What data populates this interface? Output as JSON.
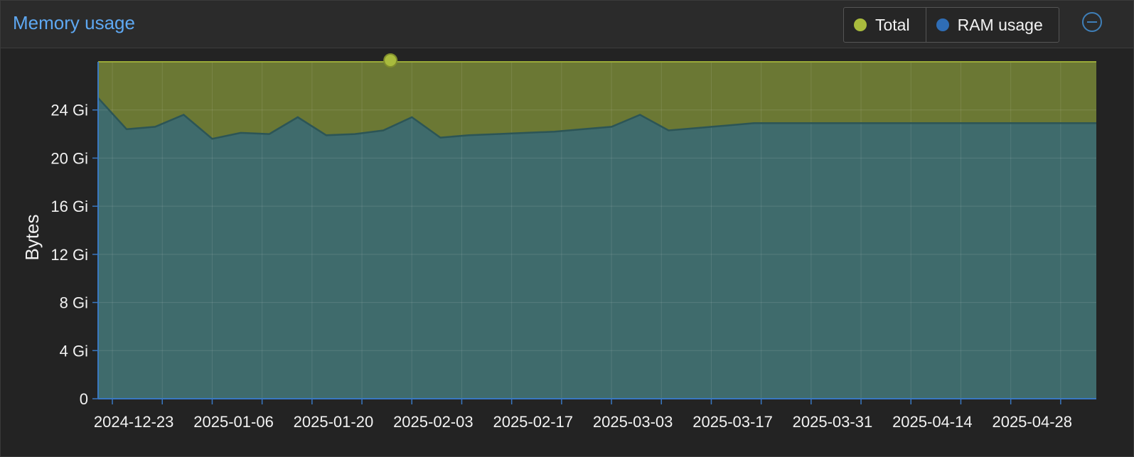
{
  "panel": {
    "title": "Memory usage"
  },
  "legend": [
    {
      "name": "Total",
      "color": "#a9bb3d"
    },
    {
      "name": "RAM usage",
      "color": "#2f6db5"
    }
  ],
  "chart_data": {
    "type": "area",
    "title": "Memory usage",
    "ylabel": "Bytes",
    "xlabel": "",
    "unit": "Gi",
    "ylim": [
      0,
      28
    ],
    "yticks": [
      0,
      4,
      8,
      12,
      16,
      20,
      24
    ],
    "ytick_labels": [
      "0",
      "4 Gi",
      "8 Gi",
      "12 Gi",
      "16 Gi",
      "20 Gi",
      "24 Gi"
    ],
    "xlim": [
      "2024-12-18",
      "2025-05-07"
    ],
    "xtick_labels": [
      "2024-12-23",
      "2025-01-06",
      "2025-01-20",
      "2025-02-03",
      "2025-02-17",
      "2025-03-03",
      "2025-03-17",
      "2025-03-31",
      "2025-04-14",
      "2025-04-28"
    ],
    "grid": true,
    "legend_position": "top-right",
    "x": [
      "2024-12-18",
      "2024-12-22",
      "2024-12-26",
      "2024-12-30",
      "2025-01-03",
      "2025-01-07",
      "2025-01-11",
      "2025-01-15",
      "2025-01-19",
      "2025-01-23",
      "2025-01-27",
      "2025-01-31",
      "2025-02-04",
      "2025-02-08",
      "2025-02-12",
      "2025-02-16",
      "2025-02-20",
      "2025-02-24",
      "2025-02-28",
      "2025-03-04",
      "2025-03-08",
      "2025-03-12",
      "2025-03-16",
      "2025-03-20",
      "2025-03-24",
      "2025-03-28",
      "2025-04-01",
      "2025-04-05",
      "2025-04-09",
      "2025-04-13",
      "2025-04-17",
      "2025-04-21",
      "2025-04-25",
      "2025-04-29",
      "2025-05-03",
      "2025-05-07"
    ],
    "series": [
      {
        "name": "Total",
        "color": "#a9bb3d",
        "values": [
          28,
          28,
          28,
          28,
          28,
          28,
          28,
          28,
          28,
          28,
          28,
          28,
          28,
          28,
          28,
          28,
          28,
          28,
          28,
          28,
          28,
          28,
          28,
          28,
          28,
          28,
          28,
          28,
          28,
          28,
          28,
          28,
          28,
          28,
          28,
          28
        ]
      },
      {
        "name": "RAM usage",
        "color": "#2f6db5",
        "values": [
          25.0,
          22.4,
          22.6,
          23.6,
          21.6,
          22.1,
          22.0,
          23.4,
          21.9,
          22.0,
          22.3,
          23.4,
          21.7,
          21.9,
          22.0,
          22.1,
          22.2,
          22.4,
          22.6,
          23.6,
          22.3,
          22.5,
          22.7,
          22.9,
          22.9,
          22.9,
          22.9,
          22.9,
          22.9,
          22.9,
          22.9,
          22.9,
          22.9,
          22.9,
          22.9,
          22.9
        ]
      }
    ]
  }
}
